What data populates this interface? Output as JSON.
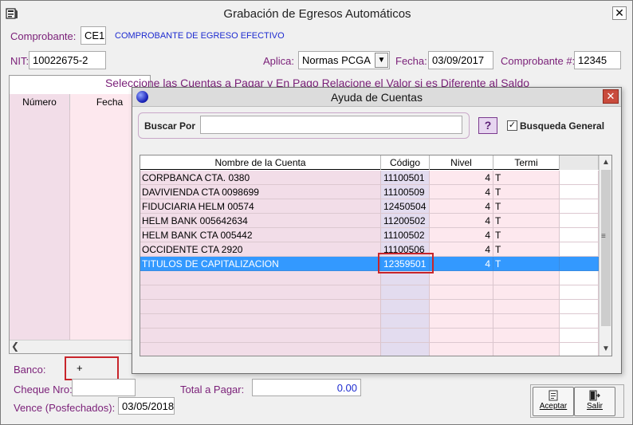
{
  "window": {
    "title": "Grabación de Egresos Automáticos",
    "close_label": "✕"
  },
  "header": {
    "comprobante_label": "Comprobante:",
    "comprobante_value": "CE1",
    "comprobante_desc": "COMPROBANTE DE EGRESO EFECTIVO",
    "nit_label": "NIT:",
    "nit_value": "10022675-2",
    "aplica_label": "Aplica:",
    "aplica_value": "Normas PCGA",
    "fecha_label": "Fecha:",
    "fecha_value": "03/09/2017",
    "comprobante_num_label": "Comprobante #:",
    "comprobante_num_value": "12345"
  },
  "background_grid": {
    "headline": "Seleccione las Cuentas a Pagar y En Pago Relacione el Valor si es Diferente al Saldo",
    "columns": [
      "Número",
      "Fecha"
    ]
  },
  "footer": {
    "banco_label": "Banco:",
    "banco_value": "+",
    "cheque_label": "Cheque Nro:",
    "cheque_value": "",
    "total_label": "Total a Pagar:",
    "total_value": "0.00",
    "vence_label": "Vence (Posfechados):",
    "vence_value": "03/05/2018"
  },
  "buttons": {
    "aceptar": "Aceptar",
    "salir": "Salir"
  },
  "dialog": {
    "title": "Ayuda de Cuentas",
    "close_label": "✕",
    "search_label": "Buscar Por",
    "search_value": "",
    "help_label": "?",
    "general_checked": true,
    "general_label": "Busqueda General",
    "columns": [
      "Nombre de la Cuenta",
      "Código",
      "Nivel",
      "Termi",
      ""
    ],
    "rows": [
      {
        "name": "CORPBANCA CTA. 0380",
        "code": "11100501",
        "level": "4",
        "term": "T"
      },
      {
        "name": "DAVIVIENDA CTA 0098699",
        "code": "11100509",
        "level": "4",
        "term": "T"
      },
      {
        "name": "FIDUCIARIA HELM 00574",
        "code": "12450504",
        "level": "4",
        "term": "T"
      },
      {
        "name": "HELM BANK 005642634",
        "code": "11200502",
        "level": "4",
        "term": "T"
      },
      {
        "name": "HELM BANK CTA 005442",
        "code": "11100502",
        "level": "4",
        "term": "T"
      },
      {
        "name": "OCCIDENTE CTA 2920",
        "code": "11100506",
        "level": "4",
        "term": "T"
      },
      {
        "name": "TITULOS DE CAPITALIZACION",
        "code": "12359501",
        "level": "4",
        "term": "T"
      }
    ],
    "selected_row": 6
  },
  "colors": {
    "label": "#7a1f78",
    "link": "#1d2bd0",
    "selection": "#3399ff",
    "highlight_box": "#c8252b"
  }
}
